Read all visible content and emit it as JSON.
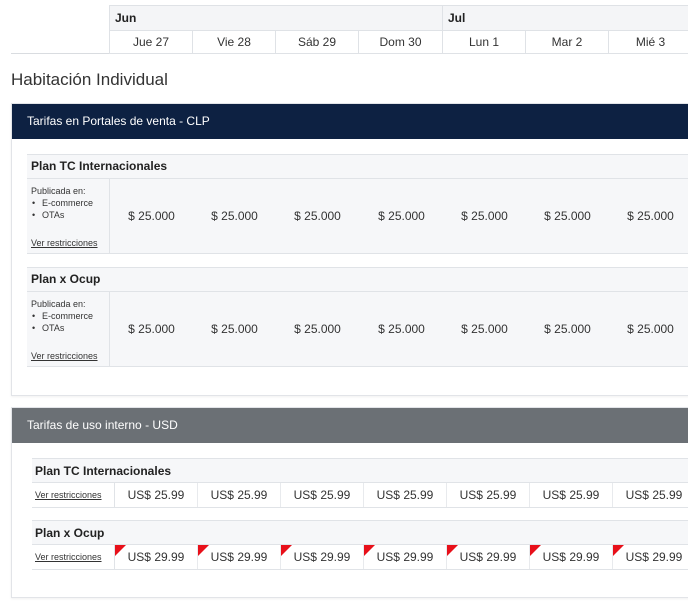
{
  "calendar": {
    "months": [
      {
        "label": "Jun"
      },
      {
        "label": "Jul"
      }
    ],
    "days": [
      "Jue 27",
      "Vie 28",
      "Sáb 29",
      "Dom 30",
      "Lun 1",
      "Mar 2",
      "Mié 3"
    ]
  },
  "room": {
    "title": "Habitación Individual"
  },
  "sales_section": {
    "header": "Tarifas en Portales de venta - CLP",
    "header_color": "#0d2142",
    "plans": [
      {
        "name": "Plan TC Internacionales",
        "published_label": "Publicada en:",
        "channels": [
          "E-commerce",
          "OTAs"
        ],
        "restrictions_link": "Ver restricciones",
        "prices": [
          "$ 25.000",
          "$ 25.000",
          "$ 25.000",
          "$ 25.000",
          "$ 25.000",
          "$ 25.000",
          "$ 25.000"
        ]
      },
      {
        "name": "Plan x Ocup",
        "published_label": "Publicada en:",
        "channels": [
          "E-commerce",
          "OTAs"
        ],
        "restrictions_link": "Ver restricciones",
        "prices": [
          "$ 25.000",
          "$ 25.000",
          "$ 25.000",
          "$ 25.000",
          "$ 25.000",
          "$ 25.000",
          "$ 25.000"
        ]
      }
    ]
  },
  "internal_section": {
    "header": "Tarifas de uso interno - USD",
    "header_color": "#6b7075",
    "plans": [
      {
        "name": "Plan TC Internacionales",
        "restrictions_link": "Ver restricciones",
        "prices": [
          "US$ 25.99",
          "US$ 25.99",
          "US$ 25.99",
          "US$ 25.99",
          "US$ 25.99",
          "US$ 25.99",
          "US$ 25.99"
        ],
        "flagged": false
      },
      {
        "name": "Plan x Ocup",
        "restrictions_link": "Ver restricciones",
        "prices": [
          "US$ 29.99",
          "US$ 29.99",
          "US$ 29.99",
          "US$ 29.99",
          "US$ 29.99",
          "US$ 29.99",
          "US$ 29.99"
        ],
        "flagged": true,
        "flag_color": "#e8101a"
      }
    ]
  }
}
